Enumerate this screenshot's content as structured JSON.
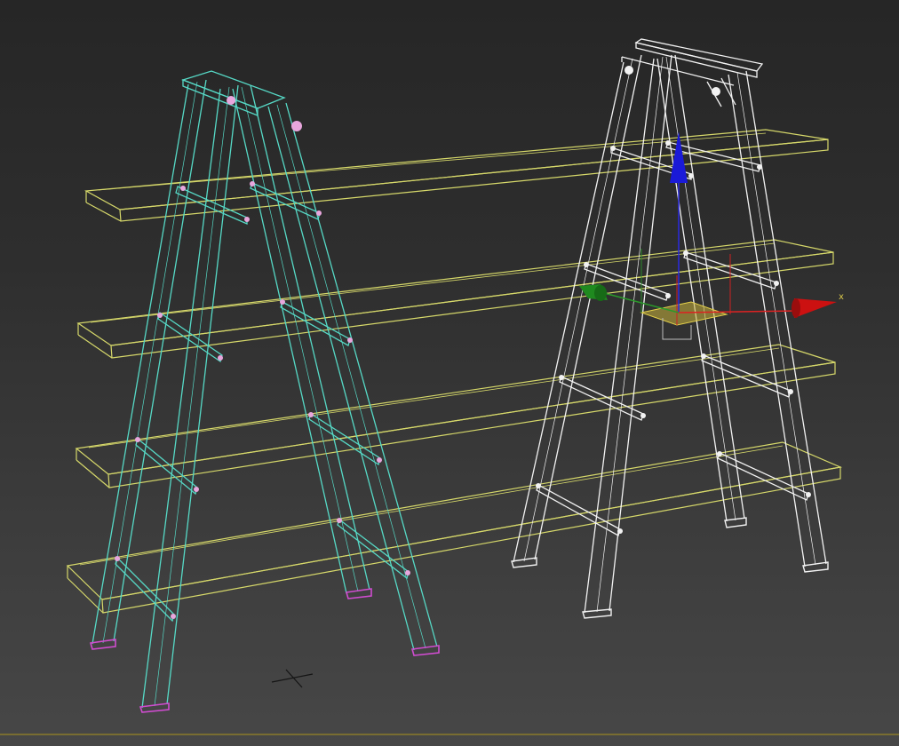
{
  "viewport": {
    "gizmo_axis_label_x": "x"
  },
  "colors": {
    "left_ladder": "#56d9c6",
    "right_ladder": "#f2f2f2",
    "shelves": "#d6d86a",
    "foot": "#d04cd0",
    "vertex": "#e8a6dd",
    "gizmo_x": "#cc1111",
    "gizmo_y": "#1f8a1f",
    "gizmo_z": "#1a1ad8",
    "gizmo_plane": "#c8b23a",
    "bottom_edge": "#8a7a2a"
  },
  "gizmo": {
    "axes": [
      "x",
      "y",
      "z"
    ],
    "mode": "move"
  }
}
